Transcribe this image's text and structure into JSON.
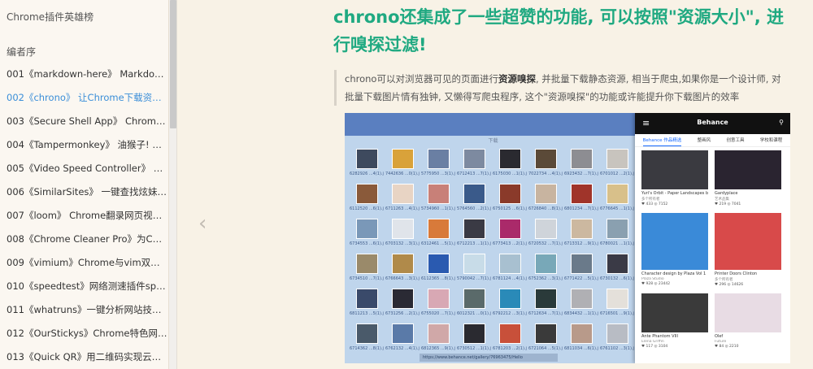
{
  "sidebar": {
    "title": "Chrome插件英雄榜",
    "subtitle": "编者序",
    "items": [
      {
        "label": "001《markdown-here》 Markdown—..."
      },
      {
        "label": "002《chrono》 让Chrome下载资源更..."
      },
      {
        "label": "003《Secure Shell App》 Chrome中..."
      },
      {
        "label": "004《Tampermonkey》 油猴子! 给浏..."
      },
      {
        "label": "005《Video Speed Controller》 刷课..."
      },
      {
        "label": "006《SimilarSites》 一键查找炫妹网..."
      },
      {
        "label": "007《loom》 Chrome翻录网页视频..."
      },
      {
        "label": "008《Chrome Cleaner Pro》为Chro..."
      },
      {
        "label": "009《vimium》Chrome与vim双神器..."
      },
      {
        "label": "010《speedtest》网络测速插件spee..."
      },
      {
        "label": "011《whatruns》一键分析网站技术栈"
      },
      {
        "label": "012《OurStickys》Chrome特色网页..."
      },
      {
        "label": "013《Quick QR》用二维码实现云粘贴"
      }
    ],
    "active_index": 1,
    "active_color": "#3a8ed8"
  },
  "nav": {
    "prev_icon": "‹"
  },
  "main": {
    "heading": "chrono还集成了一些超赞的功能, 可以按照\"资源大小\", 进行嗅探过滤!",
    "heading_color": "#1fa981",
    "quote_part1": "chrono可以对浏览器可见的页面进行",
    "quote_bold": "资源嗅探",
    "quote_part2": ", 并批量下载静态资源, 相当于爬虫,如果你是一个设计师, 对批量下载图片情有独钟, 又懒得写爬虫程序, 这个\"资源嗅探\"的功能或许能提升你下载图片的效率"
  },
  "screenshot": {
    "grid_header": "下载",
    "url": "https://www.behance.net/gallery/76963475/Hello",
    "file_names": [
      "6282926 ...4(1).jpg",
      "7442636 ...0(1).jpg",
      "5775950 ...3(1).jpg",
      "6712413 ...7(1).jpg",
      "6175030 ...1(1).jpg",
      "7022734 ...4(1).jpg",
      "6923432 ...7(1).jpg",
      "6701012 ...2(1).jpg",
      "6112520 ...6(1).jpg",
      "6711263 ...4(1).jpg",
      "5734960 ...1(1).jpg",
      "5764560 ...2(1).jpg",
      "6750125 ...6(1).jpg",
      "6726840 ...8(1).jpg",
      "6801234 ...7(1).jpg",
      "6776645 ...1(1).jpg",
      "6734553 ...6(1).jpg",
      "6703132 ...3(1).jpg",
      "6312461 ...5(1).jpg",
      "6712213 ...1(1).jpg",
      "6773413 ...2(1).jpg",
      "6720532 ...7(1).jpg",
      "6713312 ...9(1).jpg",
      "6780021 ...1(1).jpg",
      "6734510 ...7(1).jpg",
      "6766643 ...3(1).jpg",
      "6112365 ...8(1).jpg",
      "5790042 ...7(1).jpg",
      "6781124 ...4(1).jpg",
      "6752362 ...3(1).jpg",
      "6771422 ...5(1).jpg",
      "6730132 ...6(1).jpg",
      "6811213 ...5(1).jpg",
      "6731256 ...2(1).jpg",
      "6755020 ...7(1).jpg",
      "6012321 ...0(1).jpg",
      "6792212 ...3(1).jpg",
      "6712634 ...7(1).jpg",
      "6834432 ...1(1).jpg",
      "6716501 ...9(1).jpg",
      "6714362 ...8(1).jpg",
      "6762132 ...4(1).jpg",
      "6812365 ...9(1).jpg",
      "6730512 ...1(1).jpg",
      "6781203 ...2(1).jpg",
      "6721064 ...5(1).jpg",
      "6811034 ...6(1).jpg",
      "6761102 ...3(1).jpg"
    ],
    "thumb_colors": [
      "#3e4a5e",
      "#d9a23a",
      "#6a7fa3",
      "#7d8aa0",
      "#2a2a30",
      "#5b4a38",
      "#8d8d92",
      "#c8c4be",
      "#8a5a3a",
      "#e8d4c4",
      "#c88078",
      "#3a5a8a",
      "#8a3a2a",
      "#c8b4a0",
      "#a0342a",
      "#d8c08a",
      "#7a98b8",
      "#e0e4ea",
      "#d87a3a",
      "#3a3a44",
      "#aa2a6a",
      "#cfd4da",
      "#ccb8a0",
      "#8aa0b0",
      "#9a8a6a",
      "#b08a4a",
      "#2a5ab0",
      "#c8dce8",
      "#a8c0d0",
      "#78a8b8",
      "#6a7a8a",
      "#3a3a46",
      "#3a4a6a",
      "#2a2a34",
      "#d8a8b4",
      "#5a6a6a",
      "#2a8ab8",
      "#2a3a3a",
      "#b0b0b4",
      "#e4e0da",
      "#4a5a6a",
      "#5a7aa8",
      "#d0a8a8",
      "#2a2a30",
      "#c8503a",
      "#3a3a3a",
      "#b89a8a",
      "#b8bcc4"
    ],
    "behance": {
      "title": "Behance",
      "menu_icon": "≡",
      "search_icon": "⚲",
      "tabs": [
        "Behance 作品精选",
        "整画风",
        "创意工具",
        "学校和课程"
      ],
      "cards": [
        {
          "title": "Yuri's Orbit - Paper Landscapes by tell",
          "owner": "多个所有者",
          "stats": "♥ 433 ◎ 7152"
        },
        {
          "title": "Gardyplace",
          "owner": "艺术品集",
          "stats": "♥ 219 ◎ 7041"
        },
        {
          "title": "Character design by Plaza Vol 1",
          "owner": "Plaza Studio",
          "stats": "♥ 928 ◎ 23442"
        },
        {
          "title": "Printer Doors Clinton",
          "owner": "多个所有者",
          "stats": "♥ 296 ◎ 14626"
        },
        {
          "title": "Ante Phantom VIII",
          "owner": "Elena Griffin",
          "stats": "♥ 117 ◎ 3104"
        },
        {
          "title": "Olef",
          "owner": "Future",
          "stats": "♥ 84 ◎ 2210"
        }
      ],
      "card_colors": [
        "#3a3a40",
        "#2a2430",
        "#3a8ad8",
        "#d84a4a",
        "#3a3a3a",
        "#e8dce4"
      ]
    }
  }
}
